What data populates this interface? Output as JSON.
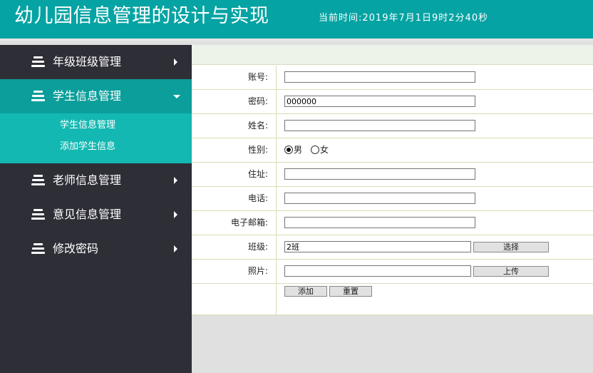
{
  "header": {
    "title": "幼儿园信息管理的设计与实现",
    "time": "当前时间:2019年7月1日9时2分40秒"
  },
  "sidebar": {
    "items": [
      {
        "label": "年级班级管理",
        "expanded": false
      },
      {
        "label": "学生信息管理",
        "expanded": true,
        "children": [
          {
            "label": "学生信息管理"
          },
          {
            "label": "添加学生信息"
          }
        ]
      },
      {
        "label": "老师信息管理",
        "expanded": false
      },
      {
        "label": "意见信息管理",
        "expanded": false
      },
      {
        "label": "修改密码",
        "expanded": false
      }
    ]
  },
  "form": {
    "account": {
      "label": "账号:",
      "value": ""
    },
    "password": {
      "label": "密码:",
      "value": "000000"
    },
    "name": {
      "label": "姓名:",
      "value": ""
    },
    "gender": {
      "label": "性别:",
      "options": [
        "男",
        "女"
      ],
      "selected": "男"
    },
    "address": {
      "label": "住址:",
      "value": ""
    },
    "phone": {
      "label": "电话:",
      "value": ""
    },
    "email": {
      "label": "电子邮箱:",
      "value": ""
    },
    "class": {
      "label": "班级:",
      "value": "2班",
      "button": "选择"
    },
    "photo": {
      "label": "照片:",
      "value": "",
      "button": "上传"
    },
    "actions": {
      "submit": "添加",
      "reset": "重置"
    }
  },
  "colors": {
    "header_bg": "#05a3a3",
    "sidebar_bg": "#2e2e37",
    "active_item_bg": "#0b9e9a",
    "submenu_bg": "#13b8b2"
  }
}
